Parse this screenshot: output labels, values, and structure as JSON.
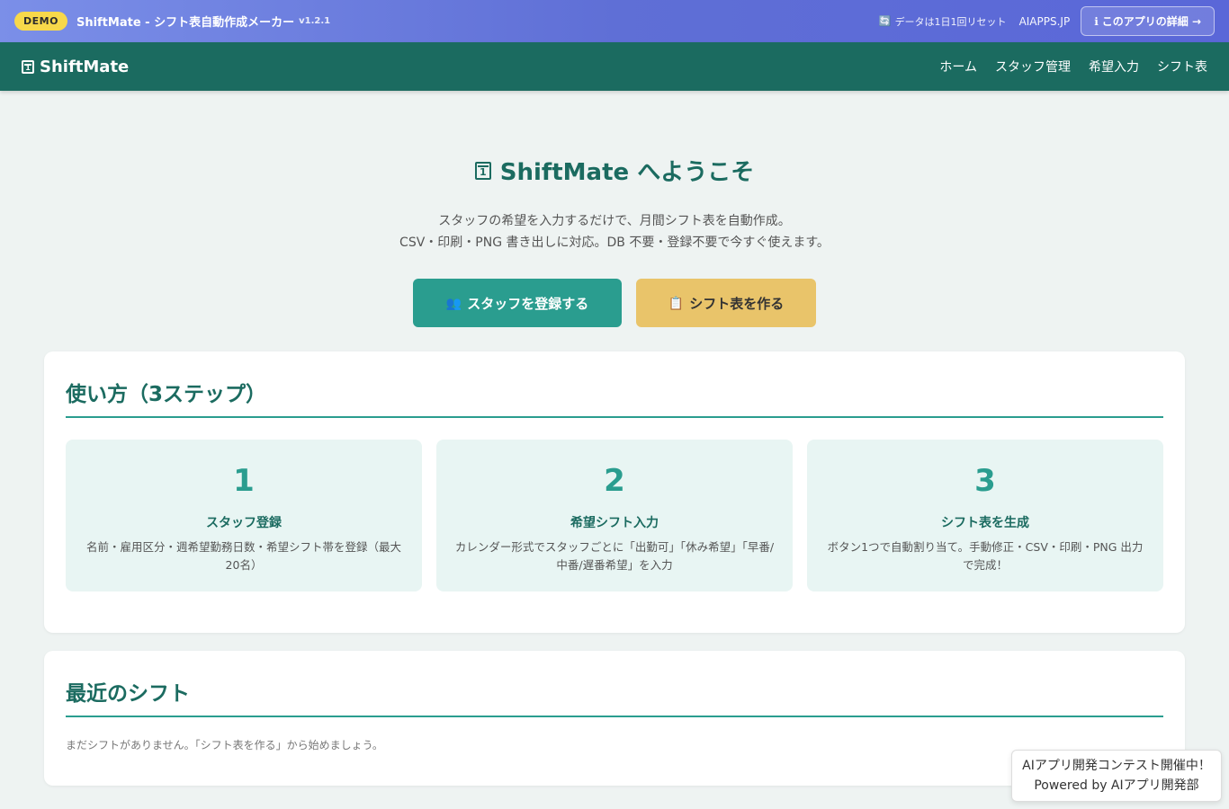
{
  "demo_bar": {
    "badge": "DEMO",
    "title": "ShiftMate - シフト表自動作成メーカー",
    "version": "v1.2.1",
    "reset_note": "データは1日1回リセット",
    "site": "AIAPPS.JP",
    "detail_button": "このアプリの詳細 →"
  },
  "nav": {
    "brand": "ShiftMate",
    "links": [
      "ホーム",
      "スタッフ管理",
      "希望入力",
      "シフト表"
    ]
  },
  "hero": {
    "title": "ShiftMate へようこそ",
    "desc_line1": "スタッフの希望を入力するだけで、月間シフト表を自動作成。",
    "desc_line2": "CSV・印刷・PNG 書き出しに対応。DB 不要・登録不要で今すぐ使えます。",
    "primary_button": "スタッフを登録する",
    "secondary_button": "シフト表を作る"
  },
  "how_to": {
    "title": "使い方（3ステップ）",
    "steps": [
      {
        "num": "1",
        "title": "スタッフ登録",
        "desc": "名前・雇用区分・週希望勤務日数・希望シフト帯を登録（最大20名）"
      },
      {
        "num": "2",
        "title": "希望シフト入力",
        "desc": "カレンダー形式でスタッフごとに「出勤可」「休み希望」「早番/中番/遅番希望」を入力"
      },
      {
        "num": "3",
        "title": "シフト表を生成",
        "desc": "ボタン1つで自動割り当て。手動修正・CSV・印刷・PNG 出力で完成！"
      }
    ]
  },
  "recent": {
    "title": "最近のシフト",
    "empty": "まだシフトがありません。「シフト表を作る」から始めましょう。"
  },
  "contest": {
    "line1": "AIアプリ開発コンテスト開催中！",
    "line2": "Powered by AIアプリ開発部"
  }
}
